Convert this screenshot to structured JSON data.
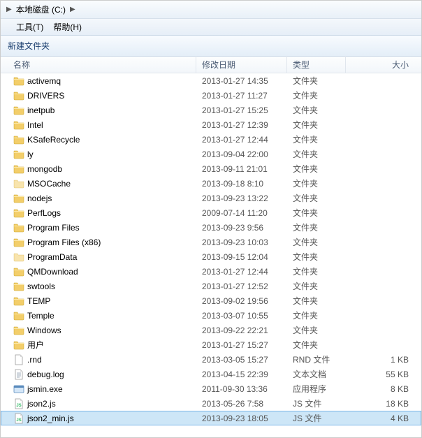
{
  "breadcrumb": {
    "location": "本地磁盘 (C:)"
  },
  "menu": {
    "tools": "工具(T)",
    "help": "帮助(H)"
  },
  "toolbar": {
    "new_folder": "新建文件夹"
  },
  "columns": {
    "name": "名称",
    "date": "修改日期",
    "type": "类型",
    "size": "大小"
  },
  "rows": [
    {
      "icon": "folder",
      "name": "activemq",
      "date": "2013-01-27 14:35",
      "type": "文件夹",
      "size": ""
    },
    {
      "icon": "folder",
      "name": "DRIVERS",
      "date": "2013-01-27 11:27",
      "type": "文件夹",
      "size": ""
    },
    {
      "icon": "folder",
      "name": "inetpub",
      "date": "2013-01-27 15:25",
      "type": "文件夹",
      "size": ""
    },
    {
      "icon": "folder",
      "name": "Intel",
      "date": "2013-01-27 12:39",
      "type": "文件夹",
      "size": ""
    },
    {
      "icon": "folder",
      "name": "KSafeRecycle",
      "date": "2013-01-27 12:44",
      "type": "文件夹",
      "size": ""
    },
    {
      "icon": "folder",
      "name": "ly",
      "date": "2013-09-04 22:00",
      "type": "文件夹",
      "size": ""
    },
    {
      "icon": "folder",
      "name": "mongodb",
      "date": "2013-09-11 21:01",
      "type": "文件夹",
      "size": ""
    },
    {
      "icon": "folder-dim",
      "name": "MSOCache",
      "date": "2013-09-18 8:10",
      "type": "文件夹",
      "size": ""
    },
    {
      "icon": "folder",
      "name": "nodejs",
      "date": "2013-09-23 13:22",
      "type": "文件夹",
      "size": ""
    },
    {
      "icon": "folder",
      "name": "PerfLogs",
      "date": "2009-07-14 11:20",
      "type": "文件夹",
      "size": ""
    },
    {
      "icon": "folder",
      "name": "Program Files",
      "date": "2013-09-23 9:56",
      "type": "文件夹",
      "size": ""
    },
    {
      "icon": "folder",
      "name": "Program Files (x86)",
      "date": "2013-09-23 10:03",
      "type": "文件夹",
      "size": ""
    },
    {
      "icon": "folder-dim",
      "name": "ProgramData",
      "date": "2013-09-15 12:04",
      "type": "文件夹",
      "size": ""
    },
    {
      "icon": "folder",
      "name": "QMDownload",
      "date": "2013-01-27 12:44",
      "type": "文件夹",
      "size": ""
    },
    {
      "icon": "folder",
      "name": "swtools",
      "date": "2013-01-27 12:52",
      "type": "文件夹",
      "size": ""
    },
    {
      "icon": "folder",
      "name": "TEMP",
      "date": "2013-09-02 19:56",
      "type": "文件夹",
      "size": ""
    },
    {
      "icon": "folder",
      "name": "Temple",
      "date": "2013-03-07 10:55",
      "type": "文件夹",
      "size": ""
    },
    {
      "icon": "folder",
      "name": "Windows",
      "date": "2013-09-22 22:21",
      "type": "文件夹",
      "size": ""
    },
    {
      "icon": "folder",
      "name": "用户",
      "date": "2013-01-27 15:27",
      "type": "文件夹",
      "size": ""
    },
    {
      "icon": "file",
      "name": ".rnd",
      "date": "2013-03-05 15:27",
      "type": "RND 文件",
      "size": "1 KB"
    },
    {
      "icon": "text",
      "name": "debug.log",
      "date": "2013-04-15 22:39",
      "type": "文本文档",
      "size": "55 KB"
    },
    {
      "icon": "exe",
      "name": "jsmin.exe",
      "date": "2011-09-30 13:36",
      "type": "应用程序",
      "size": "8 KB"
    },
    {
      "icon": "js",
      "name": "json2.js",
      "date": "2013-05-26 7:58",
      "type": "JS 文件",
      "size": "18 KB"
    },
    {
      "icon": "js",
      "name": "json2_min.js",
      "date": "2013-09-23 18:05",
      "type": "JS 文件",
      "size": "4 KB",
      "selected": true
    }
  ]
}
